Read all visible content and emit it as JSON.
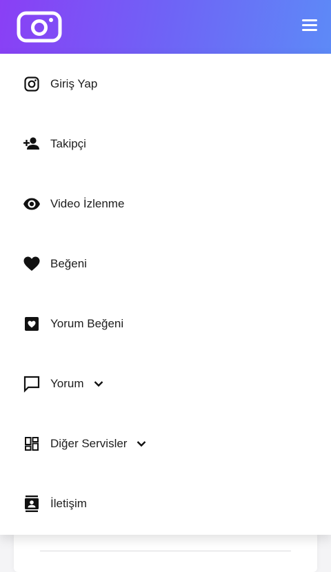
{
  "header": {
    "logo_icon": "instagram-logo-icon",
    "menu_icon": "hamburger-menu-icon",
    "gradient_colors": [
      "#8a3ff5",
      "#6f63f6",
      "#5d8af7"
    ]
  },
  "menu": {
    "items": [
      {
        "label": "Giriş Yap",
        "icon": "instagram-icon"
      },
      {
        "label": "Takipçi",
        "icon": "person-add-icon"
      },
      {
        "label": "Video İzlenme",
        "icon": "eye-icon"
      },
      {
        "label": "Beğeni",
        "icon": "heart-icon"
      },
      {
        "label": "Yorum Beğeni",
        "icon": "heart-square-icon"
      },
      {
        "label": "Yorum",
        "icon": "comment-icon",
        "has_dropdown": true
      },
      {
        "label": "Diğer Servisler",
        "icon": "dashboard-icon",
        "has_dropdown": true
      },
      {
        "label": "İletişim",
        "icon": "contacts-icon"
      }
    ]
  }
}
